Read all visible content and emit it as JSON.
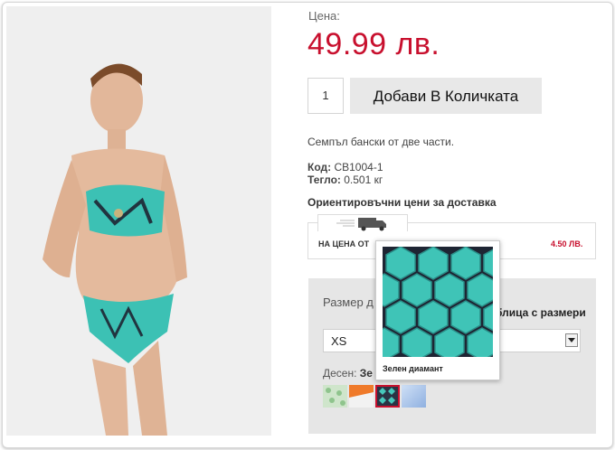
{
  "product": {
    "price_label": "Цена:",
    "price": "49.99 лв.",
    "quantity": "1",
    "add_to_cart": "Добави В Количката",
    "description": "Семпъл бански от две части.",
    "code_label": "Код:",
    "code": "CB1004-1",
    "weight_label": "Тегло:",
    "weight": "0.501 кг"
  },
  "shipping": {
    "title": "Ориентировъчни цени за доставка",
    "row_label": "НА ЦЕНА ОТ",
    "row_price": "4.50 ЛВ.",
    "icon": "truck-icon"
  },
  "options": {
    "size_label": "Размер д",
    "size_table_link": "блица с размери",
    "size_selected": "XS",
    "pattern_label": "Десен:",
    "pattern_selected": "Зе"
  },
  "swatches": [
    {
      "name": "green-floral",
      "color": "#a9cfa8"
    },
    {
      "name": "orange-white",
      "color": "#ef7a2a"
    },
    {
      "name": "green-diamond",
      "color": "#3cc1b4"
    },
    {
      "name": "blue-gradient",
      "color": "#a9c3e8"
    }
  ],
  "tooltip": {
    "caption": "Зелен диамант"
  },
  "colors": {
    "accent": "#c8102e",
    "selected_swatch_border": "#c8102e"
  }
}
